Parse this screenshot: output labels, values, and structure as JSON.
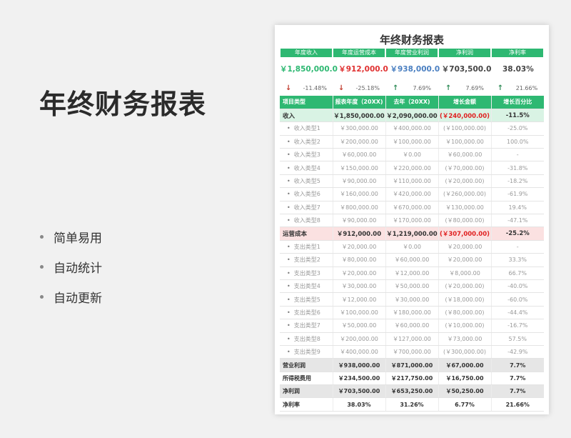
{
  "page_title": "年终财务报表",
  "bullets": [
    "简单易用",
    "自动统计",
    "自动更新"
  ],
  "sheet": {
    "title": "年终财务报表",
    "kpis": [
      {
        "label": "年度收入",
        "value": "￥1,850,000.0",
        "color": "#2eb872",
        "pct": "-11.48%",
        "dir": "down"
      },
      {
        "label": "年度运营成本",
        "value": "￥912,000.0",
        "color": "#e03131",
        "pct": "-25.18%",
        "dir": "down"
      },
      {
        "label": "年度营业利润",
        "value": "￥938,000.0",
        "color": "#4a7fc1",
        "pct": "7.69%",
        "dir": "up"
      },
      {
        "label": "净利润",
        "value": "￥703,500.0",
        "color": "#444444",
        "pct": "7.69%",
        "dir": "up"
      },
      {
        "label": "净利率",
        "value": "38.03%",
        "color": "#444444",
        "pct": "21.66%",
        "dir": "up"
      }
    ],
    "headers": [
      "项目类型",
      "报表年度（20XX)",
      "去年（20XX)",
      "增长金额",
      "增长百分比"
    ],
    "rows": [
      {
        "type": "sec-green",
        "cells": [
          "收入",
          "￥1,850,000.00",
          "￥2,090,000.00",
          "(￥240,000.00)",
          "-11.5%"
        ],
        "neg": true
      },
      {
        "type": "item",
        "cells": [
          "收入类型1",
          "￥300,000.00",
          "￥400,000.00",
          "(￥100,000.00)",
          "-25.0%"
        ],
        "neg": true
      },
      {
        "type": "item",
        "cells": [
          "收入类型2",
          "￥200,000.00",
          "￥100,000.00",
          "￥100,000.00",
          "100.0%"
        ],
        "neg": false
      },
      {
        "type": "item",
        "cells": [
          "收入类型3",
          "￥60,000.00",
          "￥0.00",
          "￥60,000.00",
          "-"
        ],
        "neg": false
      },
      {
        "type": "item",
        "cells": [
          "收入类型4",
          "￥150,000.00",
          "￥220,000.00",
          "(￥70,000.00)",
          "-31.8%"
        ],
        "neg": true
      },
      {
        "type": "item",
        "cells": [
          "收入类型5",
          "￥90,000.00",
          "￥110,000.00",
          "(￥20,000.00)",
          "-18.2%"
        ],
        "neg": true
      },
      {
        "type": "item",
        "cells": [
          "收入类型6",
          "￥160,000.00",
          "￥420,000.00",
          "(￥260,000.00)",
          "-61.9%"
        ],
        "neg": true
      },
      {
        "type": "item",
        "cells": [
          "收入类型7",
          "￥800,000.00",
          "￥670,000.00",
          "￥130,000.00",
          "19.4%"
        ],
        "neg": false
      },
      {
        "type": "item",
        "cells": [
          "收入类型8",
          "￥90,000.00",
          "￥170,000.00",
          "(￥80,000.00)",
          "-47.1%"
        ],
        "neg": true
      },
      {
        "type": "sec-red",
        "cells": [
          "运营成本",
          "￥912,000.00",
          "￥1,219,000.00",
          "(￥307,000.00)",
          "-25.2%"
        ],
        "neg": true
      },
      {
        "type": "item",
        "cells": [
          "支出类型1",
          "￥20,000.00",
          "￥0.00",
          "￥20,000.00",
          "-"
        ],
        "neg": false
      },
      {
        "type": "item",
        "cells": [
          "支出类型2",
          "￥80,000.00",
          "￥60,000.00",
          "￥20,000.00",
          "33.3%"
        ],
        "neg": false
      },
      {
        "type": "item",
        "cells": [
          "支出类型3",
          "￥20,000.00",
          "￥12,000.00",
          "￥8,000.00",
          "66.7%"
        ],
        "neg": false
      },
      {
        "type": "item",
        "cells": [
          "支出类型4",
          "￥30,000.00",
          "￥50,000.00",
          "(￥20,000.00)",
          "-40.0%"
        ],
        "neg": true
      },
      {
        "type": "item",
        "cells": [
          "支出类型5",
          "￥12,000.00",
          "￥30,000.00",
          "(￥18,000.00)",
          "-60.0%"
        ],
        "neg": true
      },
      {
        "type": "item",
        "cells": [
          "支出类型6",
          "￥100,000.00",
          "￥180,000.00",
          "(￥80,000.00)",
          "-44.4%"
        ],
        "neg": true
      },
      {
        "type": "item",
        "cells": [
          "支出类型7",
          "￥50,000.00",
          "￥60,000.00",
          "(￥10,000.00)",
          "-16.7%"
        ],
        "neg": true
      },
      {
        "type": "item",
        "cells": [
          "支出类型8",
          "￥200,000.00",
          "￥127,000.00",
          "￥73,000.00",
          "57.5%"
        ],
        "neg": false
      },
      {
        "type": "item",
        "cells": [
          "支出类型9",
          "￥400,000.00",
          "￥700,000.00",
          "(￥300,000.00)",
          "-42.9%"
        ],
        "neg": true
      },
      {
        "type": "gray",
        "cells": [
          "营业利润",
          "￥938,000.00",
          "￥871,000.00",
          "￥67,000.00",
          "7.7%"
        ],
        "neg": false
      },
      {
        "type": "white-b",
        "cells": [
          "所得税费用",
          "￥234,500.00",
          "￥217,750.00",
          "￥16,750.00",
          "7.7%"
        ],
        "neg": false
      },
      {
        "type": "gray",
        "cells": [
          "净利润",
          "￥703,500.00",
          "￥653,250.00",
          "￥50,250.00",
          "7.7%"
        ],
        "neg": false
      },
      {
        "type": "white-b",
        "cells": [
          "净利率",
          "38.03%",
          "31.26%",
          "6.77%",
          "21.66%"
        ],
        "neg": false
      }
    ]
  }
}
